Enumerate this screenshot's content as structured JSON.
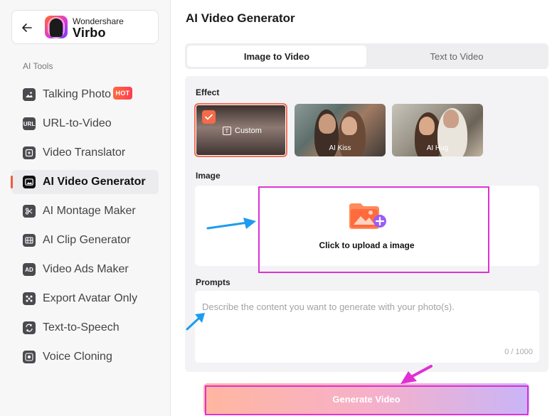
{
  "brand": {
    "top_text": "Wondershare",
    "name": "Virbo"
  },
  "sidebar": {
    "section_label": "AI Tools",
    "hot_badge": "HOT",
    "items": [
      {
        "label": "Talking Photo",
        "icon": "image-icon"
      },
      {
        "label": "URL-to-Video",
        "icon": "url-icon"
      },
      {
        "label": "Video Translator",
        "icon": "translate-icon"
      },
      {
        "label": "AI Video Generator",
        "icon": "video-generator-icon",
        "active": true
      },
      {
        "label": "AI Montage Maker",
        "icon": "scissors-icon"
      },
      {
        "label": "AI Clip Generator",
        "icon": "clip-icon"
      },
      {
        "label": "Video Ads Maker",
        "icon": "ad-icon"
      },
      {
        "label": "Export Avatar Only",
        "icon": "avatar-icon"
      },
      {
        "label": "Text-to-Speech",
        "icon": "speech-icon"
      },
      {
        "label": "Voice Cloning",
        "icon": "voice-icon"
      }
    ]
  },
  "main": {
    "title": "AI Video Generator",
    "tabs": [
      {
        "label": "Image to Video",
        "active": true
      },
      {
        "label": "Text to Video",
        "active": false
      }
    ],
    "effect_label": "Effect",
    "effects": [
      {
        "label": "Custom",
        "selected": true
      },
      {
        "label": "AI Kiss",
        "selected": false
      },
      {
        "label": "AI Hug",
        "selected": false
      }
    ],
    "image_label": "Image",
    "upload_text": "Click to upload a image",
    "prompts_label": "Prompts",
    "prompt_placeholder": "Describe the content you want to generate with your photo(s).",
    "prompt_value": "",
    "counter": "0 / 1000",
    "generate_label": "Generate Video"
  },
  "colors": {
    "accent": "#f25a38",
    "annotation_highlight": "#e030d4",
    "annotation_arrow": "#1e9bf0"
  }
}
